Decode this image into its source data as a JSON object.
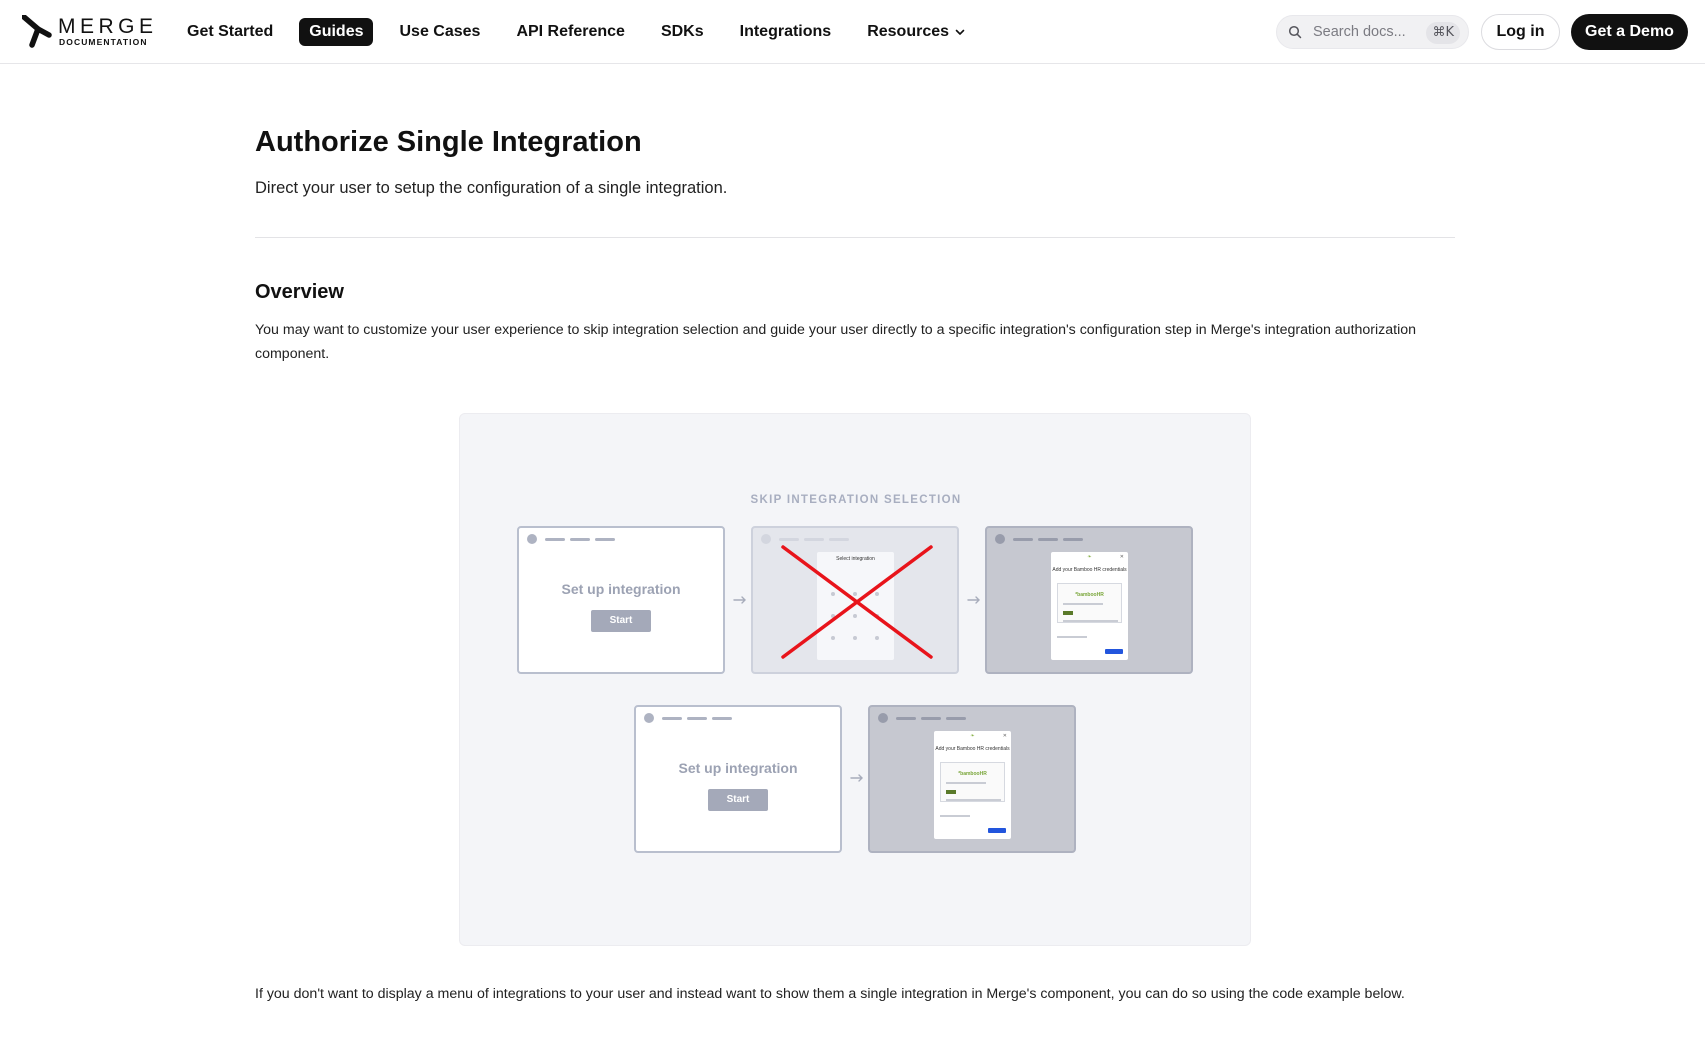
{
  "logo": {
    "word": "MERGE",
    "sub": "DOCUMENTATION",
    "mark_icon": "merge-logo-icon"
  },
  "nav": {
    "items": [
      {
        "label": "Get Started",
        "active": false
      },
      {
        "label": "Guides",
        "active": true
      },
      {
        "label": "Use Cases",
        "active": false
      },
      {
        "label": "API Reference",
        "active": false
      },
      {
        "label": "SDKs",
        "active": false
      },
      {
        "label": "Integrations",
        "active": false
      },
      {
        "label": "Resources",
        "active": false,
        "icon": "chevron-down-icon"
      }
    ]
  },
  "search": {
    "placeholder": "Search docs...",
    "shortcut": "⌘K",
    "icon": "search-icon"
  },
  "header_buttons": {
    "login": "Log in",
    "demo": "Get a Demo"
  },
  "page": {
    "title": "Authorize Single Integration",
    "subtitle": "Direct your user to setup the configuration of a single integration.",
    "overview_heading": "Overview",
    "overview_text": "You may want to customize your user experience to skip integration selection and guide your user directly to a specific integration's configuration step in Merge's integration authorization component.",
    "followup_text": "If you don't want to display a menu of integrations to your user and instead want to show them a single integration in Merge's component, you can do so using the code example below."
  },
  "illustration": {
    "label": "SKIP INTEGRATION SELECTION",
    "card_title": "Set up integration",
    "card_button": "Start",
    "modal_title": "Add your Bamboo HR credentials",
    "modal_brand": "*bambooHR",
    "select_title": "Select integration",
    "colors": {
      "background": "#f4f5f8",
      "cross": "#e8141b",
      "primary": "#2255dd"
    }
  },
  "colors": {
    "text": "#111111",
    "active_nav_bg": "#111111",
    "demo_button_bg": "#111111"
  }
}
